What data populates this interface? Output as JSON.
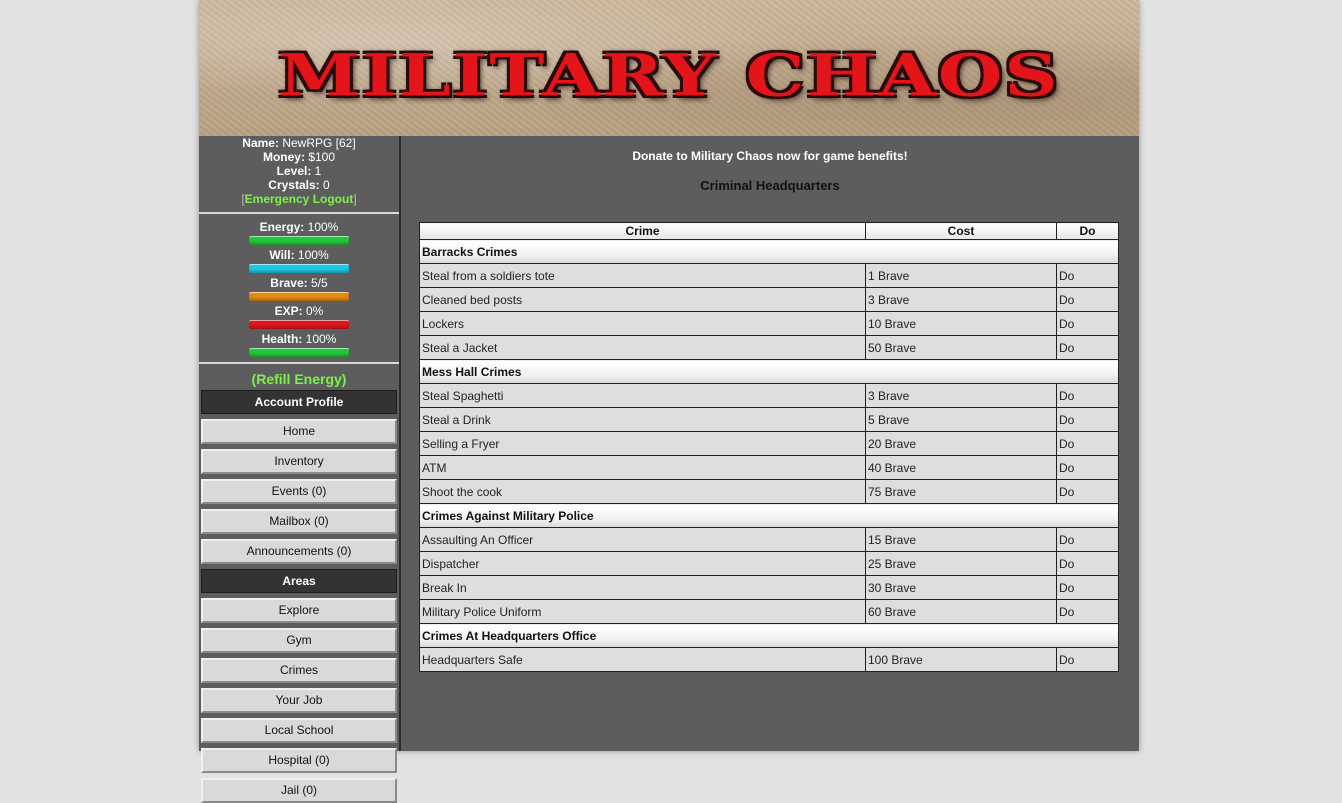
{
  "banner": {
    "title": "MILITARY CHAOS"
  },
  "player": {
    "name_label": "Name:",
    "name_value": "NewRPG [62]",
    "money_label": "Money:",
    "money_value": "$100",
    "level_label": "Level:",
    "level_value": "1",
    "crystals_label": "Crystals:",
    "crystals_value": "0",
    "logout_open": "[",
    "logout_label": "Emergency Logout",
    "logout_close": "]"
  },
  "bars": [
    {
      "label": "Energy:",
      "value": "100%",
      "fill": 1.0,
      "color": "#22c63a"
    },
    {
      "label": "Will:",
      "value": "100%",
      "fill": 1.0,
      "color": "#1ec8e0"
    },
    {
      "label": "Brave:",
      "value": "5/5",
      "fill": 1.0,
      "color": "#e08a12"
    },
    {
      "label": "EXP:",
      "value": "0%",
      "fill": 0.0,
      "color": "#d8181a"
    },
    {
      "label": "Health:",
      "value": "100%",
      "fill": 1.0,
      "color": "#22c63a"
    }
  ],
  "refill_label": "(Refill Energy)",
  "nav": {
    "account_header": "Account Profile",
    "account_items": [
      "Home",
      "Inventory",
      "Events (0)",
      "Mailbox (0)",
      "Announcements (0)"
    ],
    "areas_header": "Areas",
    "areas_items": [
      "Explore",
      "Gym",
      "Crimes",
      "Your Job",
      "Local School",
      "Hospital (0)",
      "Jail (0)"
    ]
  },
  "main": {
    "donate_text": "Donate to Military Chaos now for game benefits!",
    "page_title": "Criminal Headquarters",
    "table_headers": [
      "Crime",
      "Cost",
      "Do"
    ],
    "groups": [
      {
        "name": "Barracks Crimes",
        "crimes": [
          {
            "name": "Steal from a soldiers tote",
            "cost": "1 Brave",
            "do": "Do"
          },
          {
            "name": "Cleaned bed posts",
            "cost": "3 Brave",
            "do": "Do"
          },
          {
            "name": "Lockers",
            "cost": "10 Brave",
            "do": "Do"
          },
          {
            "name": "Steal a Jacket",
            "cost": "50 Brave",
            "do": "Do"
          }
        ]
      },
      {
        "name": "Mess Hall Crimes",
        "crimes": [
          {
            "name": "Steal Spaghetti",
            "cost": "3 Brave",
            "do": "Do"
          },
          {
            "name": "Steal a Drink",
            "cost": "5 Brave",
            "do": "Do"
          },
          {
            "name": "Selling a Fryer",
            "cost": "20 Brave",
            "do": "Do"
          },
          {
            "name": "ATM",
            "cost": "40 Brave",
            "do": "Do"
          },
          {
            "name": "Shoot the cook",
            "cost": "75 Brave",
            "do": "Do"
          }
        ]
      },
      {
        "name": "Crimes Against Military Police",
        "crimes": [
          {
            "name": "Assaulting An Officer",
            "cost": "15 Brave",
            "do": "Do"
          },
          {
            "name": "Dispatcher",
            "cost": "25 Brave",
            "do": "Do"
          },
          {
            "name": "Break In",
            "cost": "30 Brave",
            "do": "Do"
          },
          {
            "name": "Military Police Uniform",
            "cost": "60 Brave",
            "do": "Do"
          }
        ]
      },
      {
        "name": "Crimes At Headquarters Office",
        "crimes": [
          {
            "name": "Headquarters Safe",
            "cost": "100 Brave",
            "do": "Do"
          }
        ]
      }
    ]
  }
}
